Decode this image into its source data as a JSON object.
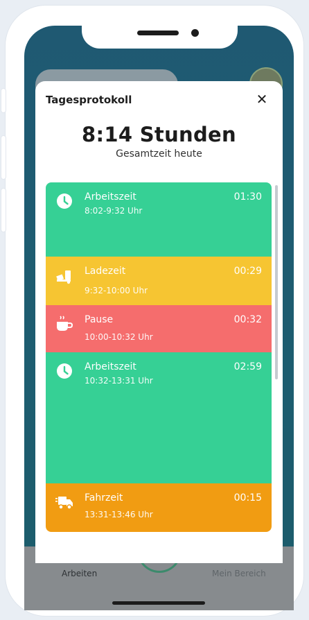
{
  "modal": {
    "title": "Tagesprotokoll",
    "close_icon": "close-icon",
    "total_time": "8:14 Stunden",
    "total_caption": "Gesamtzeit heute"
  },
  "entries": [
    {
      "label": "Arbeitszeit",
      "range": "8:02-9:32 Uhr",
      "duration": "01:30",
      "icon": "clock-icon",
      "color": "#36d095"
    },
    {
      "label": "Ladezeit",
      "range": "9:32-10:00 Uhr",
      "duration": "00:29",
      "icon": "loading-icon",
      "color": "#f6c532"
    },
    {
      "label": "Pause",
      "range": "10:00-10:32 Uhr",
      "duration": "00:32",
      "icon": "coffee-icon",
      "color": "#f56d6d"
    },
    {
      "label": "Arbeitszeit",
      "range": "10:32-13:31 Uhr",
      "duration": "02:59",
      "icon": "clock-icon",
      "color": "#36d095"
    },
    {
      "label": "Fahrzeit",
      "range": "13:31-13:46 Uhr",
      "duration": "00:15",
      "icon": "truck-icon",
      "color": "#f19c12"
    }
  ],
  "tabbar": {
    "left_label": "Arbeiten",
    "right_label": "Mein Bereich"
  }
}
